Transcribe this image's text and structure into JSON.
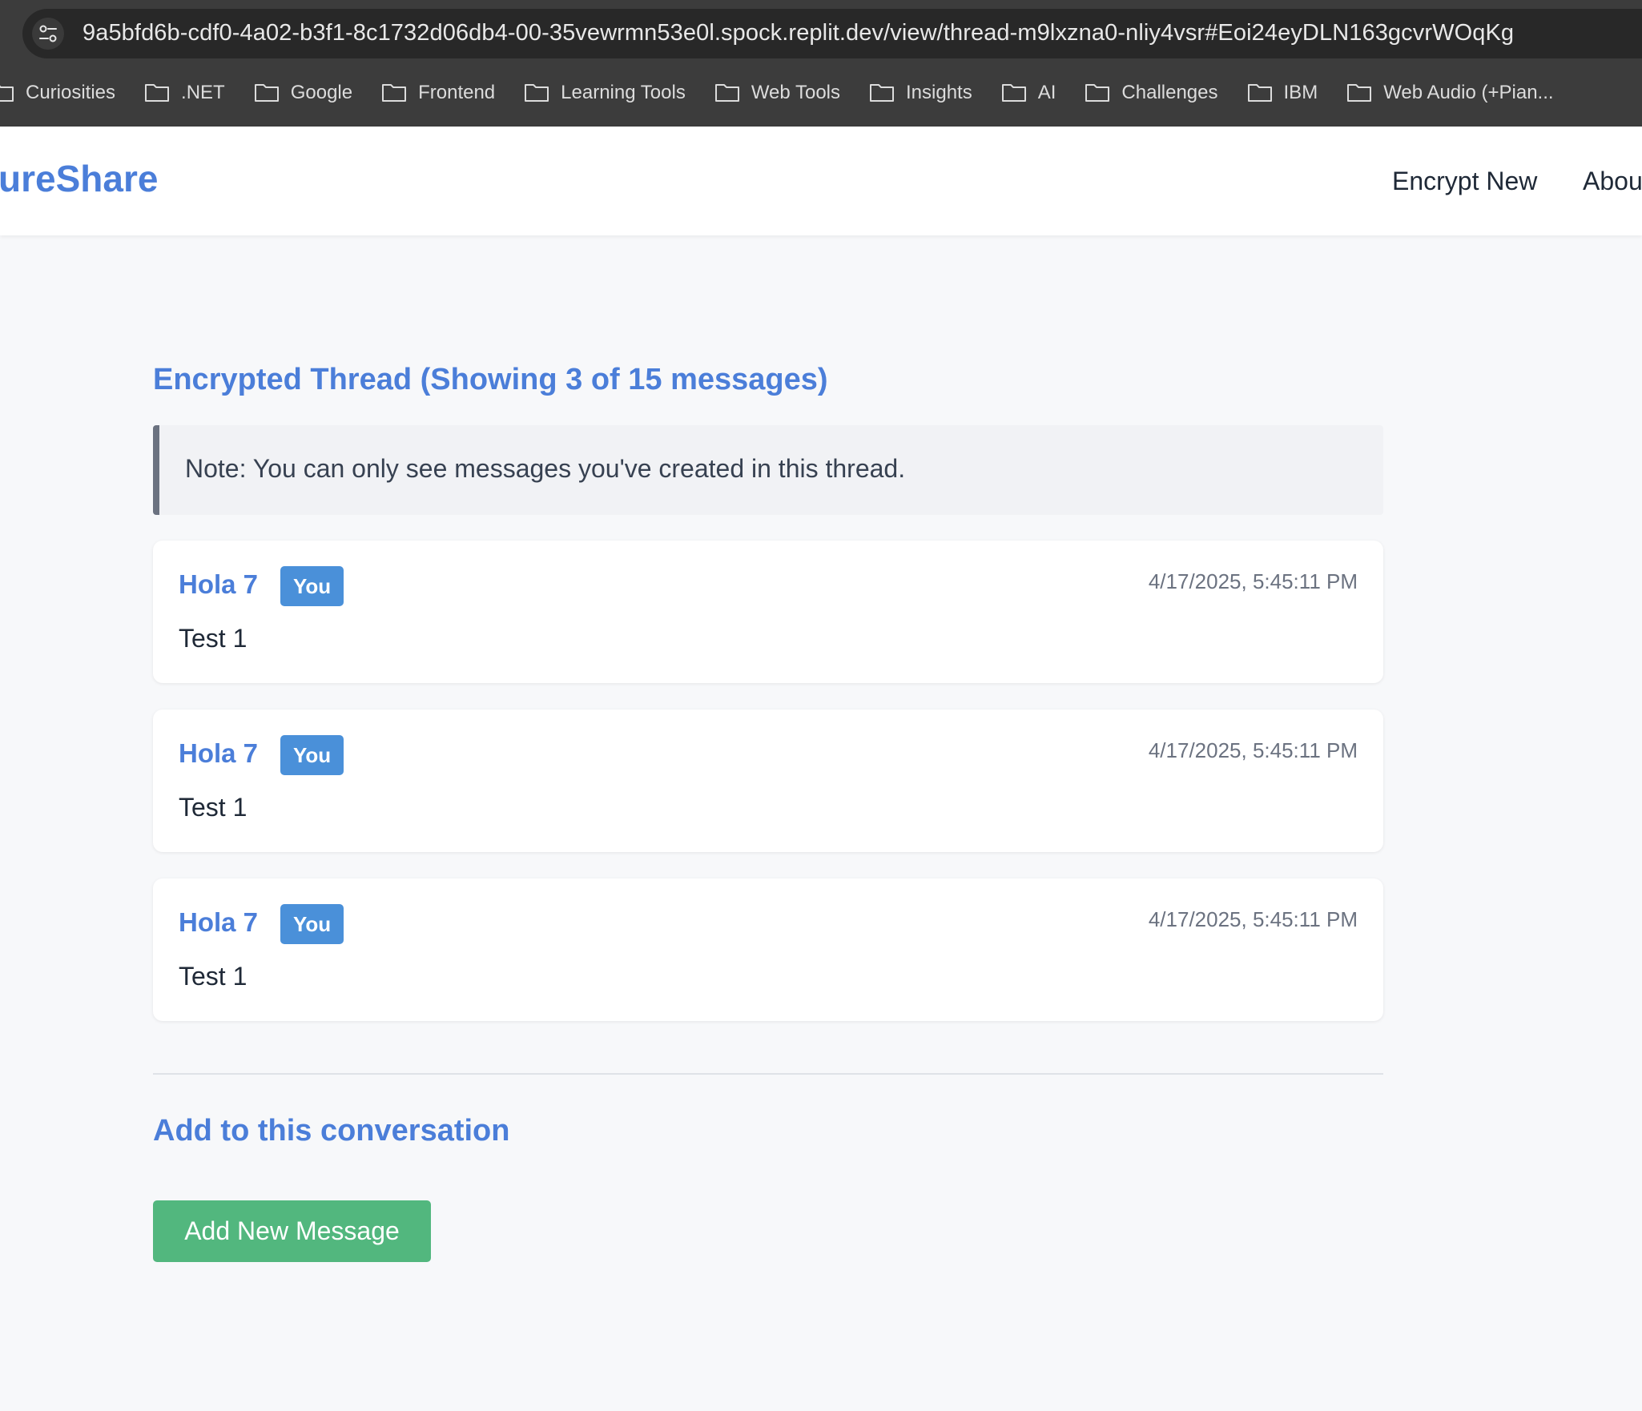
{
  "browser": {
    "url": "9a5bfd6b-cdf0-4a02-b3f1-8c1732d06db4-00-35vewrmn53e0l.spock.replit.dev/view/thread-m9lxzna0-nliy4vsr#Eoi24eyDLN163gcvrWOqKg",
    "bookmarks": [
      "Curiosities",
      ".NET",
      "Google",
      "Frontend",
      "Learning Tools",
      "Web Tools",
      "Insights",
      "AI",
      "Challenges",
      "IBM",
      "Web Audio (+Pian..."
    ]
  },
  "header": {
    "brand": "ureShare",
    "nav": [
      "Encrypt New",
      "Abou"
    ]
  },
  "thread": {
    "title": "Encrypted Thread (Showing 3 of 15 messages)",
    "note": "Note: You can only see messages you've created in this thread.",
    "messages": [
      {
        "author": "Hola 7",
        "badge": "You",
        "timestamp": "4/17/2025, 5:45:11 PM",
        "body": "Test 1"
      },
      {
        "author": "Hola 7",
        "badge": "You",
        "timestamp": "4/17/2025, 5:45:11 PM",
        "body": "Test 1"
      },
      {
        "author": "Hola 7",
        "badge": "You",
        "timestamp": "4/17/2025, 5:45:11 PM",
        "body": "Test 1"
      }
    ]
  },
  "compose": {
    "title": "Add to this conversation",
    "button": "Add New Message"
  },
  "colors": {
    "accent": "#4b7ed9",
    "badge": "#4a90d9",
    "button": "#52b77e",
    "chrome": "#3c3c3c"
  }
}
